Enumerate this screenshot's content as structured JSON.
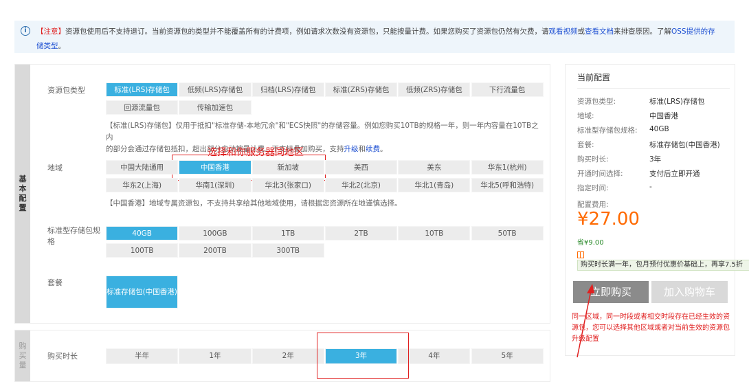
{
  "notice": {
    "prefix": "【注意】",
    "text1": "资源包使用后不支持退订。当前资源包的类型并不能覆盖所有的计费项，例如请求次数没有资源包，只能按量计费。如果您购买了资源包仍然有欠费，请",
    "link1": "观看视频",
    "or": "或",
    "link2": "查看文档",
    "text2": "来排查原因。了解",
    "link3": "OSS提供的存",
    "link3b": "储类型",
    "end": "。"
  },
  "sections": {
    "basic": "基本配置",
    "duration": "购买量"
  },
  "package_type": {
    "label": "资源包类型",
    "options": [
      "标准(LRS)存储包",
      "低频(LRS)存储包",
      "归档(LRS)存储包",
      "标准(ZRS)存储包",
      "低频(ZRS)存储包",
      "下行流量包",
      "回源流量包",
      "传输加速包"
    ],
    "desc1": "【标准(LRS)存储包】仅用于抵扣\"标准存储-本地冗余\"和\"ECS快照\"的存储容量。例如您购买10TB的规格一年，则一年内容量在10TB之内",
    "desc2": "的部分会通过存储包抵扣，超出部分自动按量计费。不支持叠加购买，支持",
    "upgrade": "升级",
    "and": "和",
    "renew": "续费",
    "period": "。"
  },
  "region": {
    "label": "地域",
    "options": [
      "中国大陆通用",
      "中国香港",
      "新加坡",
      "美西",
      "美东",
      "华东1(杭州)",
      "华东2(上海)",
      "华南1(深圳)",
      "华北3(张家口)",
      "华北2(北京)",
      "华北1(青岛)",
      "华北5(呼和浩特)"
    ],
    "desc": "【中国香港】地域专属资源包，不支持共享给其他地域使用，请根据您资源所在地谨慎选择。"
  },
  "spec": {
    "label1": "标准型存储包规",
    "label2": "格",
    "options": [
      "40GB",
      "100GB",
      "1TB",
      "2TB",
      "10TB",
      "50TB",
      "100TB",
      "200TB",
      "300TB"
    ]
  },
  "plan": {
    "label": "套餐",
    "option": "标准存储包(中国香港)"
  },
  "duration": {
    "label": "购买时长",
    "options": [
      "半年",
      "1年",
      "2年",
      "3年",
      "4年",
      "5年"
    ]
  },
  "annotation": "选择和你服务器同地区",
  "panel": {
    "title": "当前配置",
    "rows": [
      {
        "k": "资源包类型:",
        "v": "标准(LRS)存储包"
      },
      {
        "k": "地域:",
        "v": "中国香港"
      },
      {
        "k": "标准型存储包规格:",
        "v": "40GB"
      },
      {
        "k": "套餐:",
        "v": "标准存储包(中国香港)"
      },
      {
        "k": "购买时长:",
        "v": "3年"
      },
      {
        "k": "开通时间选择:",
        "v": "支付后立即开通"
      },
      {
        "k": "指定时间:",
        "v": "-"
      }
    ],
    "fee_label": "配置费用:",
    "price": "¥27.00",
    "save": "省¥9.00",
    "promo": "购买时长满一年，包月预付优惠价基础上，再享7.5折",
    "buy": "立即购买",
    "cart": "加入购物车",
    "note": "同一区域，同一时段或者相交时段存在已经生效的资源包，您可以选择其他区域或者对当前生效的资源包升级配置"
  },
  "colors": {
    "selected": "#3ab0e0",
    "price": "#ff6a00",
    "annotation": "#e02020"
  }
}
